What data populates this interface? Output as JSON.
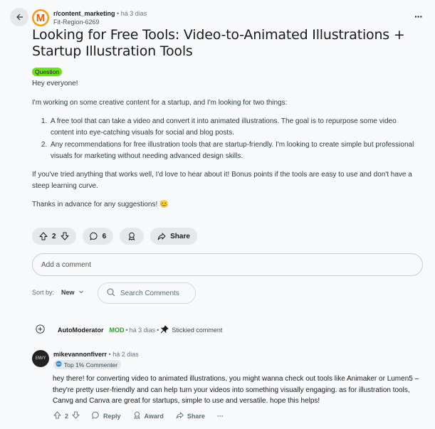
{
  "header": {
    "subreddit": "r/content_marketing",
    "time": "há 3 dias",
    "author": "Fit-Region-6269",
    "avatar_letter": "M"
  },
  "post": {
    "title": "Looking for Free Tools: Video-to-Animated Illustrations + Startup Illustration Tools",
    "flair": "Question",
    "body": {
      "greeting": "Hey everyone!",
      "intro": "I'm working on some creative content for a startup, and I'm looking for two things:",
      "list": [
        "A free tool that can take a video and convert it into animated illustrations. The goal is to repurpose some video content into eye-catching visuals for social and blog posts.",
        "Any recommendations for free illustration tools that are startup-friendly. I'm looking to create simple but professional visuals for marketing without needing advanced design skills."
      ],
      "closing": "If you've tried anything that works well, I'd love to hear about it! Bonus points if the tools are easy to use and don't have a steep learning curve.",
      "thanks": "Thanks in advance for any suggestions! 😊"
    },
    "actions": {
      "votes": "2",
      "comments": "6",
      "share_label": "Share"
    }
  },
  "comment_input": {
    "placeholder": "Add a comment"
  },
  "sort": {
    "label": "Sort by:",
    "value": "New",
    "search_placeholder": "Search Comments"
  },
  "automod": {
    "name": "AutoModerator",
    "badge": "MOD",
    "time": "há 3 dias",
    "note": "Stickied comment"
  },
  "comment": {
    "user": "mikevannonfiverr",
    "time": "há 2 dias",
    "badge": "Top 1% Commenter",
    "avatar_text": "ENVY",
    "text": "hey there! for converting video to animated illustrations, you might wanna check out tools like Animaker or Lumen5 – they're pretty user-friendly and can help turn your videos into something visually engaging. as for illustration tools, Canvg and Canva are great for startups, simple to use and versatile. hope this helps!",
    "votes": "2",
    "reply_label": "Reply",
    "award_label": "Award",
    "share_label": "Share"
  }
}
